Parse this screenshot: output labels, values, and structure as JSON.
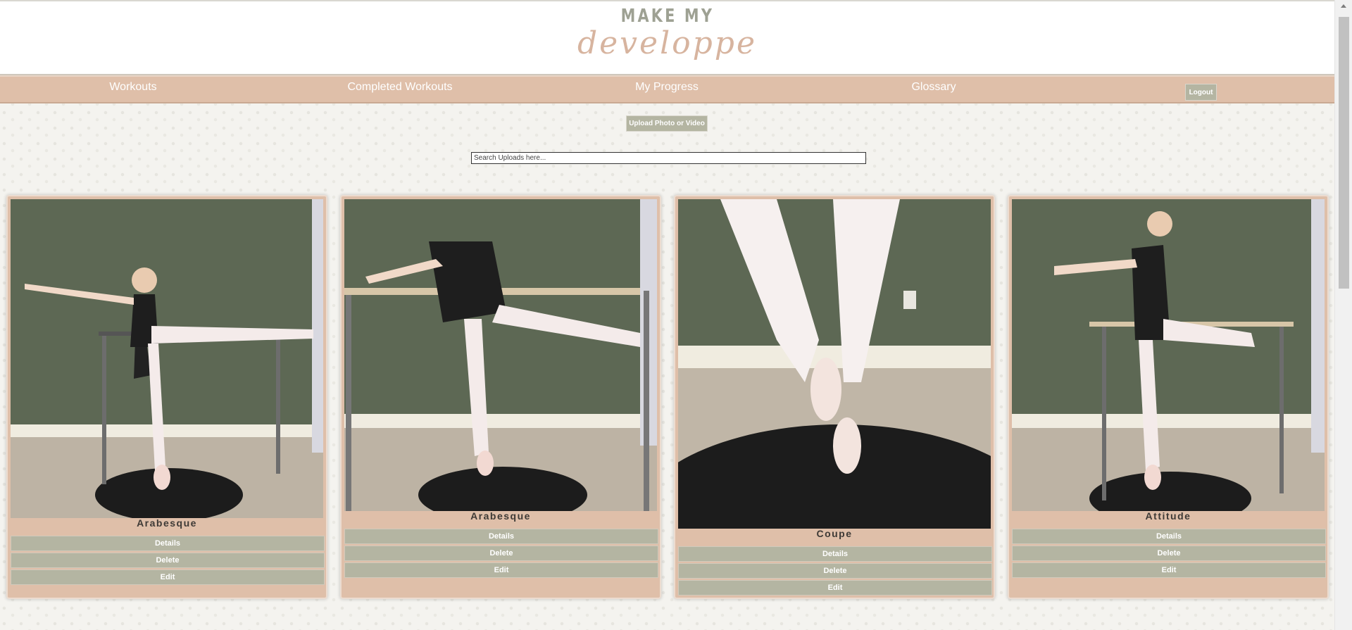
{
  "header": {
    "logo_line1": "MAKE MY",
    "logo_line2": "developpe"
  },
  "nav": {
    "items": [
      {
        "label": "Workouts"
      },
      {
        "label": "Completed Workouts"
      },
      {
        "label": "My Progress"
      },
      {
        "label": "Glossary"
      }
    ],
    "logout_label": "Logout"
  },
  "upload_button": "Upload Photo or Video",
  "search": {
    "placeholder": "Search Uploads here...",
    "value": ""
  },
  "cards": [
    {
      "title": "Arabesque",
      "photo": "dancer-arabesque-at-barre-photo",
      "buttons": [
        "Details",
        "Delete",
        "Edit"
      ]
    },
    {
      "title": "Arabesque",
      "photo": "dancer-arabesque-at-barre-photo",
      "buttons": [
        "Details",
        "Delete",
        "Edit"
      ]
    },
    {
      "title": "Coupe",
      "photo": "pointe-shoes-coupe-photo",
      "buttons": [
        "Details",
        "Delete",
        "Edit"
      ]
    },
    {
      "title": "Attitude",
      "photo": "dancer-attitude-at-barre-photo",
      "buttons": [
        "Details",
        "Delete",
        "Edit"
      ]
    }
  ],
  "colors": {
    "accent": "#dfbfa9",
    "button": "#b4b5a2",
    "logo_top": "#9ea193",
    "logo_bottom": "#d7b49f"
  }
}
